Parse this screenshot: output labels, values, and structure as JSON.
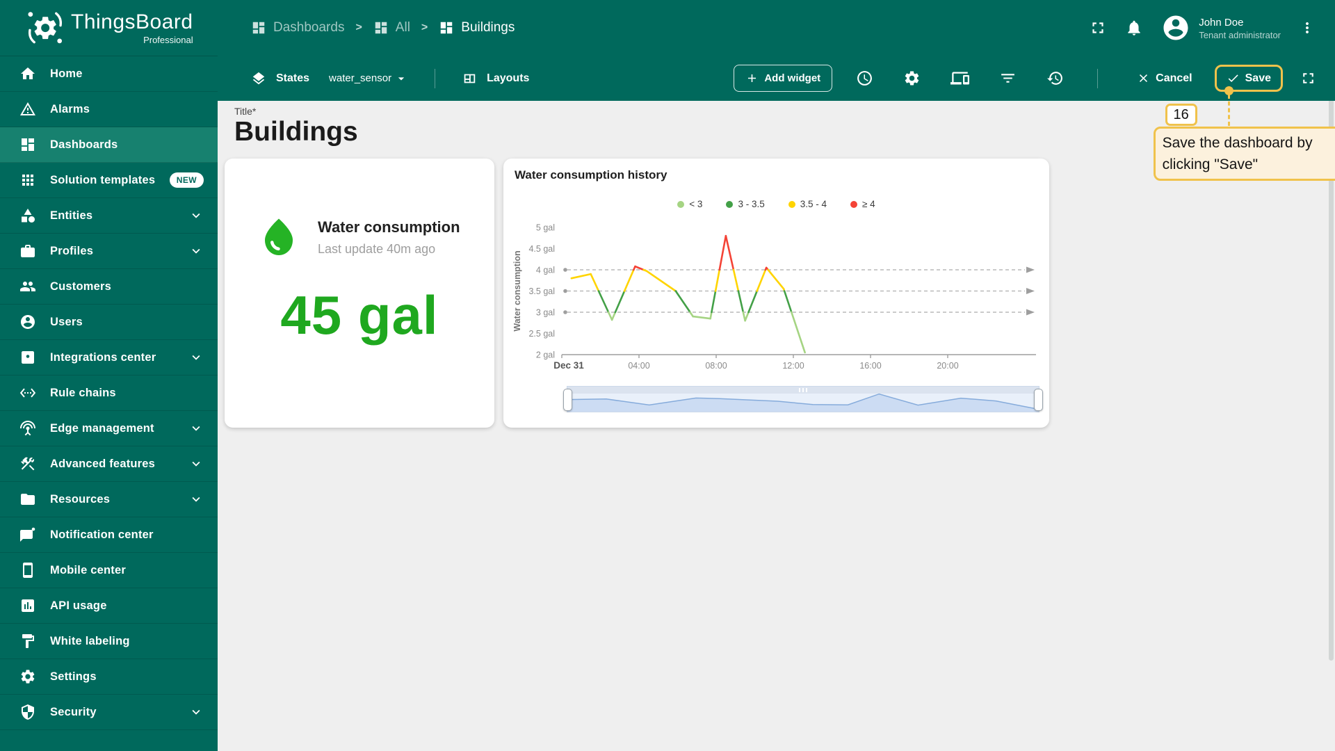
{
  "app": {
    "name": "ThingsBoard",
    "edition": "Professional"
  },
  "header": {
    "breadcrumbs": [
      {
        "label": "Dashboards",
        "icon": "dashboard-icon"
      },
      {
        "label": "All",
        "icon": "dashboard-icon"
      },
      {
        "label": "Buildings",
        "icon": "dashboard-icon"
      }
    ],
    "user": {
      "name": "John Doe",
      "role": "Tenant administrator"
    }
  },
  "toolbar": {
    "states_label": "States",
    "state_value": "water_sensor",
    "layouts_label": "Layouts",
    "add_widget_label": "Add widget",
    "cancel_label": "Cancel",
    "save_label": "Save"
  },
  "sidebar": {
    "items": [
      {
        "label": "Home",
        "icon": "home"
      },
      {
        "label": "Alarms",
        "icon": "warning"
      },
      {
        "label": "Dashboards",
        "icon": "dashboard",
        "active": true
      },
      {
        "label": "Solution templates",
        "icon": "apps",
        "badge": "NEW"
      },
      {
        "label": "Entities",
        "icon": "category",
        "expandable": true
      },
      {
        "label": "Profiles",
        "icon": "profiles",
        "expandable": true
      },
      {
        "label": "Customers",
        "icon": "people"
      },
      {
        "label": "Users",
        "icon": "account"
      },
      {
        "label": "Integrations center",
        "icon": "integration",
        "expandable": true
      },
      {
        "label": "Rule chains",
        "icon": "code"
      },
      {
        "label": "Edge management",
        "icon": "antenna",
        "expandable": true
      },
      {
        "label": "Advanced features",
        "icon": "tools",
        "expandable": true
      },
      {
        "label": "Resources",
        "icon": "folder",
        "expandable": true
      },
      {
        "label": "Notification center",
        "icon": "chat"
      },
      {
        "label": "Mobile center",
        "icon": "phone"
      },
      {
        "label": "API usage",
        "icon": "barchart"
      },
      {
        "label": "White labeling",
        "icon": "paint"
      },
      {
        "label": "Settings",
        "icon": "gear"
      },
      {
        "label": "Security",
        "icon": "shield",
        "expandable": true
      }
    ]
  },
  "page": {
    "title_label": "Title*",
    "title": "Buildings"
  },
  "widgets": {
    "latest": {
      "title": "Water consumption",
      "subtitle": "Last update 40m ago",
      "value": "45 gal"
    }
  },
  "chart_data": {
    "type": "line",
    "title": "Water consumption history",
    "ylabel": "Water consumption",
    "y_unit": "gal",
    "ylim": [
      2,
      5
    ],
    "ytick_step": 0.5,
    "xlim_hours": [
      0,
      24
    ],
    "xticks": [
      {
        "t": 0,
        "label": "Dec 31",
        "bold": true
      },
      {
        "t": 4,
        "label": "04:00"
      },
      {
        "t": 8,
        "label": "08:00"
      },
      {
        "t": 12,
        "label": "12:00"
      },
      {
        "t": 16,
        "label": "16:00"
      },
      {
        "t": 20,
        "label": "20:00"
      }
    ],
    "thresholds": [
      3,
      3.5,
      4
    ],
    "legend": [
      {
        "label": "< 3",
        "color": "#a5d483"
      },
      {
        "label": "3 - 3.5",
        "color": "#43a047"
      },
      {
        "label": "3.5 - 4",
        "color": "#ffd400"
      },
      {
        "label": "≥ 4",
        "color": "#f44336"
      }
    ],
    "series": [
      {
        "name": "Water consumption",
        "points": [
          [
            0.5,
            3.8
          ],
          [
            1.5,
            3.9
          ],
          [
            2.6,
            2.82
          ],
          [
            3.8,
            4.08
          ],
          [
            4.4,
            3.97
          ],
          [
            5.9,
            3.5
          ],
          [
            6.8,
            2.9
          ],
          [
            7.7,
            2.85
          ],
          [
            8.5,
            4.8
          ],
          [
            9.5,
            2.8
          ],
          [
            10.6,
            4.05
          ],
          [
            11.5,
            3.55
          ],
          [
            12.6,
            2.05
          ]
        ]
      }
    ]
  },
  "annotation": {
    "step": "16",
    "text": "Save the dashboard by clicking \"Save\""
  },
  "colors": {
    "header_teal": "#00695c",
    "active_teal": "#17816f",
    "accent_gold": "#f0c24b",
    "value_green": "#1fa81f",
    "drop_green": "#25b325",
    "brush_line": "#85abdb",
    "brush_fill": "#ccdcf3"
  }
}
